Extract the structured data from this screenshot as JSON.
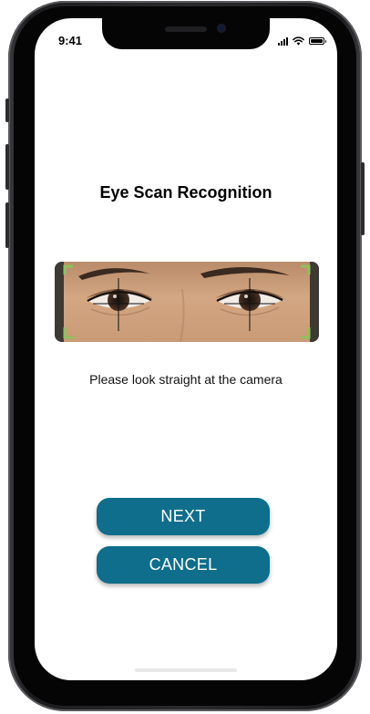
{
  "status_bar": {
    "time": "9:41"
  },
  "screen": {
    "title": "Eye Scan Recognition",
    "instruction": "Please look straight at the camera"
  },
  "buttons": {
    "next_label": "NEXT",
    "cancel_label": "CANCEL"
  },
  "colors": {
    "primary_button": "#0e6e8c",
    "scan_corner": "#8fc25a",
    "background": "#ffffff"
  },
  "icons": {
    "status": [
      "signal-icon",
      "wifi-icon",
      "battery-icon"
    ],
    "scan": [
      "eye-scan-crosshair-icon",
      "scan-corner-icon"
    ]
  }
}
